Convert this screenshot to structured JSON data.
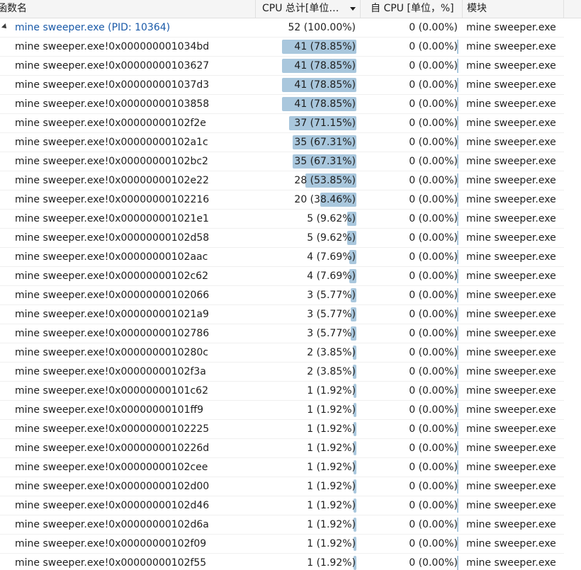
{
  "columns": {
    "function": "函数名",
    "cpu_total": "CPU 总计[单位…",
    "self_cpu": "自 CPU [单位，%]",
    "module": "模块"
  },
  "colors": {
    "bar": "#a9c7dd",
    "root_text": "#1a5aa8"
  },
  "rows": [
    {
      "fn": "mine sweeper.exe (PID: 10364)",
      "cpu": "52 (100.00%)",
      "pct": 100.0,
      "self": "0 (0.00%)",
      "module": "mine sweeper.exe",
      "root": true
    },
    {
      "fn": "mine sweeper.exe!0x000000001034bd",
      "cpu": "41 (78.85%)",
      "pct": 78.85,
      "self": "0 (0.00%)",
      "module": "mine sweeper.exe"
    },
    {
      "fn": "mine sweeper.exe!0x00000000103627",
      "cpu": "41 (78.85%)",
      "pct": 78.85,
      "self": "0 (0.00%)",
      "module": "mine sweeper.exe"
    },
    {
      "fn": "mine sweeper.exe!0x000000001037d3",
      "cpu": "41 (78.85%)",
      "pct": 78.85,
      "self": "0 (0.00%)",
      "module": "mine sweeper.exe"
    },
    {
      "fn": "mine sweeper.exe!0x00000000103858",
      "cpu": "41 (78.85%)",
      "pct": 78.85,
      "self": "0 (0.00%)",
      "module": "mine sweeper.exe"
    },
    {
      "fn": "mine sweeper.exe!0x00000000102f2e",
      "cpu": "37 (71.15%)",
      "pct": 71.15,
      "self": "0 (0.00%)",
      "module": "mine sweeper.exe"
    },
    {
      "fn": "mine sweeper.exe!0x00000000102a1c",
      "cpu": "35 (67.31%)",
      "pct": 67.31,
      "self": "0 (0.00%)",
      "module": "mine sweeper.exe"
    },
    {
      "fn": "mine sweeper.exe!0x00000000102bc2",
      "cpu": "35 (67.31%)",
      "pct": 67.31,
      "self": "0 (0.00%)",
      "module": "mine sweeper.exe"
    },
    {
      "fn": "mine sweeper.exe!0x00000000102e22",
      "cpu": "28 (53.85%)",
      "pct": 53.85,
      "self": "0 (0.00%)",
      "module": "mine sweeper.exe"
    },
    {
      "fn": "mine sweeper.exe!0x00000000102216",
      "cpu": "20 (38.46%)",
      "pct": 38.46,
      "self": "0 (0.00%)",
      "module": "mine sweeper.exe"
    },
    {
      "fn": "mine sweeper.exe!0x000000001021e1",
      "cpu": "5 (9.62%)",
      "pct": 9.62,
      "self": "0 (0.00%)",
      "module": "mine sweeper.exe"
    },
    {
      "fn": "mine sweeper.exe!0x00000000102d58",
      "cpu": "5 (9.62%)",
      "pct": 9.62,
      "self": "0 (0.00%)",
      "module": "mine sweeper.exe"
    },
    {
      "fn": "mine sweeper.exe!0x00000000102aac",
      "cpu": "4 (7.69%)",
      "pct": 7.69,
      "self": "0 (0.00%)",
      "module": "mine sweeper.exe"
    },
    {
      "fn": "mine sweeper.exe!0x00000000102c62",
      "cpu": "4 (7.69%)",
      "pct": 7.69,
      "self": "0 (0.00%)",
      "module": "mine sweeper.exe"
    },
    {
      "fn": "mine sweeper.exe!0x00000000102066",
      "cpu": "3 (5.77%)",
      "pct": 5.77,
      "self": "0 (0.00%)",
      "module": "mine sweeper.exe"
    },
    {
      "fn": "mine sweeper.exe!0x000000001021a9",
      "cpu": "3 (5.77%)",
      "pct": 5.77,
      "self": "0 (0.00%)",
      "module": "mine sweeper.exe"
    },
    {
      "fn": "mine sweeper.exe!0x00000000102786",
      "cpu": "3 (5.77%)",
      "pct": 5.77,
      "self": "0 (0.00%)",
      "module": "mine sweeper.exe"
    },
    {
      "fn": "mine sweeper.exe!0x0000000010280c",
      "cpu": "2 (3.85%)",
      "pct": 3.85,
      "self": "0 (0.00%)",
      "module": "mine sweeper.exe"
    },
    {
      "fn": "mine sweeper.exe!0x00000000102f3a",
      "cpu": "2 (3.85%)",
      "pct": 3.85,
      "self": "0 (0.00%)",
      "module": "mine sweeper.exe"
    },
    {
      "fn": "mine sweeper.exe!0x00000000101c62",
      "cpu": "1 (1.92%)",
      "pct": 1.92,
      "self": "0 (0.00%)",
      "module": "mine sweeper.exe"
    },
    {
      "fn": "mine sweeper.exe!0x00000000101ff9",
      "cpu": "1 (1.92%)",
      "pct": 1.92,
      "self": "0 (0.00%)",
      "module": "mine sweeper.exe"
    },
    {
      "fn": "mine sweeper.exe!0x00000000102225",
      "cpu": "1 (1.92%)",
      "pct": 1.92,
      "self": "0 (0.00%)",
      "module": "mine sweeper.exe"
    },
    {
      "fn": "mine sweeper.exe!0x0000000010226d",
      "cpu": "1 (1.92%)",
      "pct": 1.92,
      "self": "0 (0.00%)",
      "module": "mine sweeper.exe"
    },
    {
      "fn": "mine sweeper.exe!0x00000000102cee",
      "cpu": "1 (1.92%)",
      "pct": 1.92,
      "self": "0 (0.00%)",
      "module": "mine sweeper.exe"
    },
    {
      "fn": "mine sweeper.exe!0x00000000102d00",
      "cpu": "1 (1.92%)",
      "pct": 1.92,
      "self": "0 (0.00%)",
      "module": "mine sweeper.exe"
    },
    {
      "fn": "mine sweeper.exe!0x00000000102d46",
      "cpu": "1 (1.92%)",
      "pct": 1.92,
      "self": "0 (0.00%)",
      "module": "mine sweeper.exe"
    },
    {
      "fn": "mine sweeper.exe!0x00000000102d6a",
      "cpu": "1 (1.92%)",
      "pct": 1.92,
      "self": "0 (0.00%)",
      "module": "mine sweeper.exe"
    },
    {
      "fn": "mine sweeper.exe!0x00000000102f09",
      "cpu": "1 (1.92%)",
      "pct": 1.92,
      "self": "0 (0.00%)",
      "module": "mine sweeper.exe"
    },
    {
      "fn": "mine sweeper.exe!0x00000000102f55",
      "cpu": "1 (1.92%)",
      "pct": 1.92,
      "self": "0 (0.00%)",
      "module": "mine sweeper.exe"
    }
  ]
}
